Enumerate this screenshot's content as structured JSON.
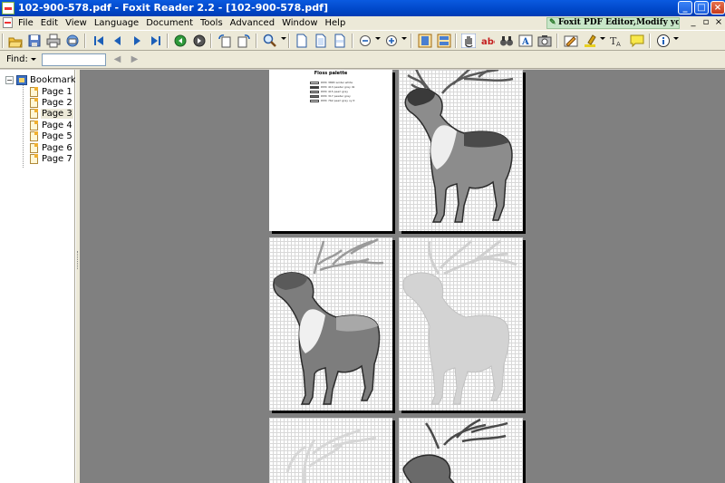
{
  "window": {
    "title": "102-900-578.pdf - Foxit Reader 2.2 - [102-900-578.pdf]",
    "buttons": {
      "minimize": "_",
      "maximize": "□",
      "close": "×"
    }
  },
  "menubar": {
    "items": [
      "File",
      "Edit",
      "View",
      "Language",
      "Document",
      "Tools",
      "Advanced",
      "Window",
      "Help"
    ],
    "ad_text": "Foxit PDF Editor,Modify your PDF!",
    "mdi": {
      "minimize": "_",
      "restore": "▫",
      "close": "×"
    }
  },
  "toolbar": {
    "icons": [
      "open-icon",
      "save-icon",
      "print-icon",
      "email-icon",
      "first-page-icon",
      "previous-page-icon",
      "next-page-icon",
      "last-page-icon",
      "go-back-icon",
      "go-forward-icon",
      "rotate-left-icon",
      "rotate-right-icon",
      "zoom-icon",
      "actual-size-icon",
      "fit-page-icon",
      "fit-width-icon",
      "zoom-out-icon",
      "zoom-in-icon",
      "single-page-icon",
      "continuous-page-icon",
      "hand-tool-icon",
      "select-text-icon",
      "find-icon",
      "typewriter-icon",
      "snapshot-icon",
      "pen-icon",
      "highlight-icon",
      "text-markup-icon",
      "note-icon",
      "info-icon"
    ]
  },
  "findbar": {
    "label": "Find:",
    "input_value": "",
    "prev_label": "◀",
    "next_label": "▶"
  },
  "bookmarks": {
    "root_label": "Bookmarks",
    "expander": "−",
    "items": [
      {
        "label": "Page 1",
        "selected": false
      },
      {
        "label": "Page 2",
        "selected": false
      },
      {
        "label": "Page 3",
        "selected": true
      },
      {
        "label": "Page 4",
        "selected": false
      },
      {
        "label": "Page 5",
        "selected": false
      },
      {
        "label": "Page 6",
        "selected": false
      },
      {
        "label": "Page 7",
        "selected": false
      }
    ]
  },
  "document": {
    "page1": {
      "title": "Floss palette",
      "entries": [
        {
          "text": "DMC 3865 winter white",
          "color": "#e6e6e6"
        },
        {
          "text": "DMC 413 pewter gray dk",
          "color": "#3a3a3a"
        },
        {
          "text": "DMC 415 pearl gray",
          "color": "#b0b0b0"
        },
        {
          "text": "DMC 317 pewter gray",
          "color": "#6a6a6a"
        },
        {
          "text": "DMC 762 pearl gray vy lt",
          "color": "#d8d8d8"
        }
      ]
    },
    "colors": {
      "view_background": "#808080",
      "deer_dark": "#2b2b2b",
      "deer_mid": "#7a7a7a",
      "deer_light": "#c4c4c4",
      "deer_faint": "#d0d0d0"
    }
  }
}
